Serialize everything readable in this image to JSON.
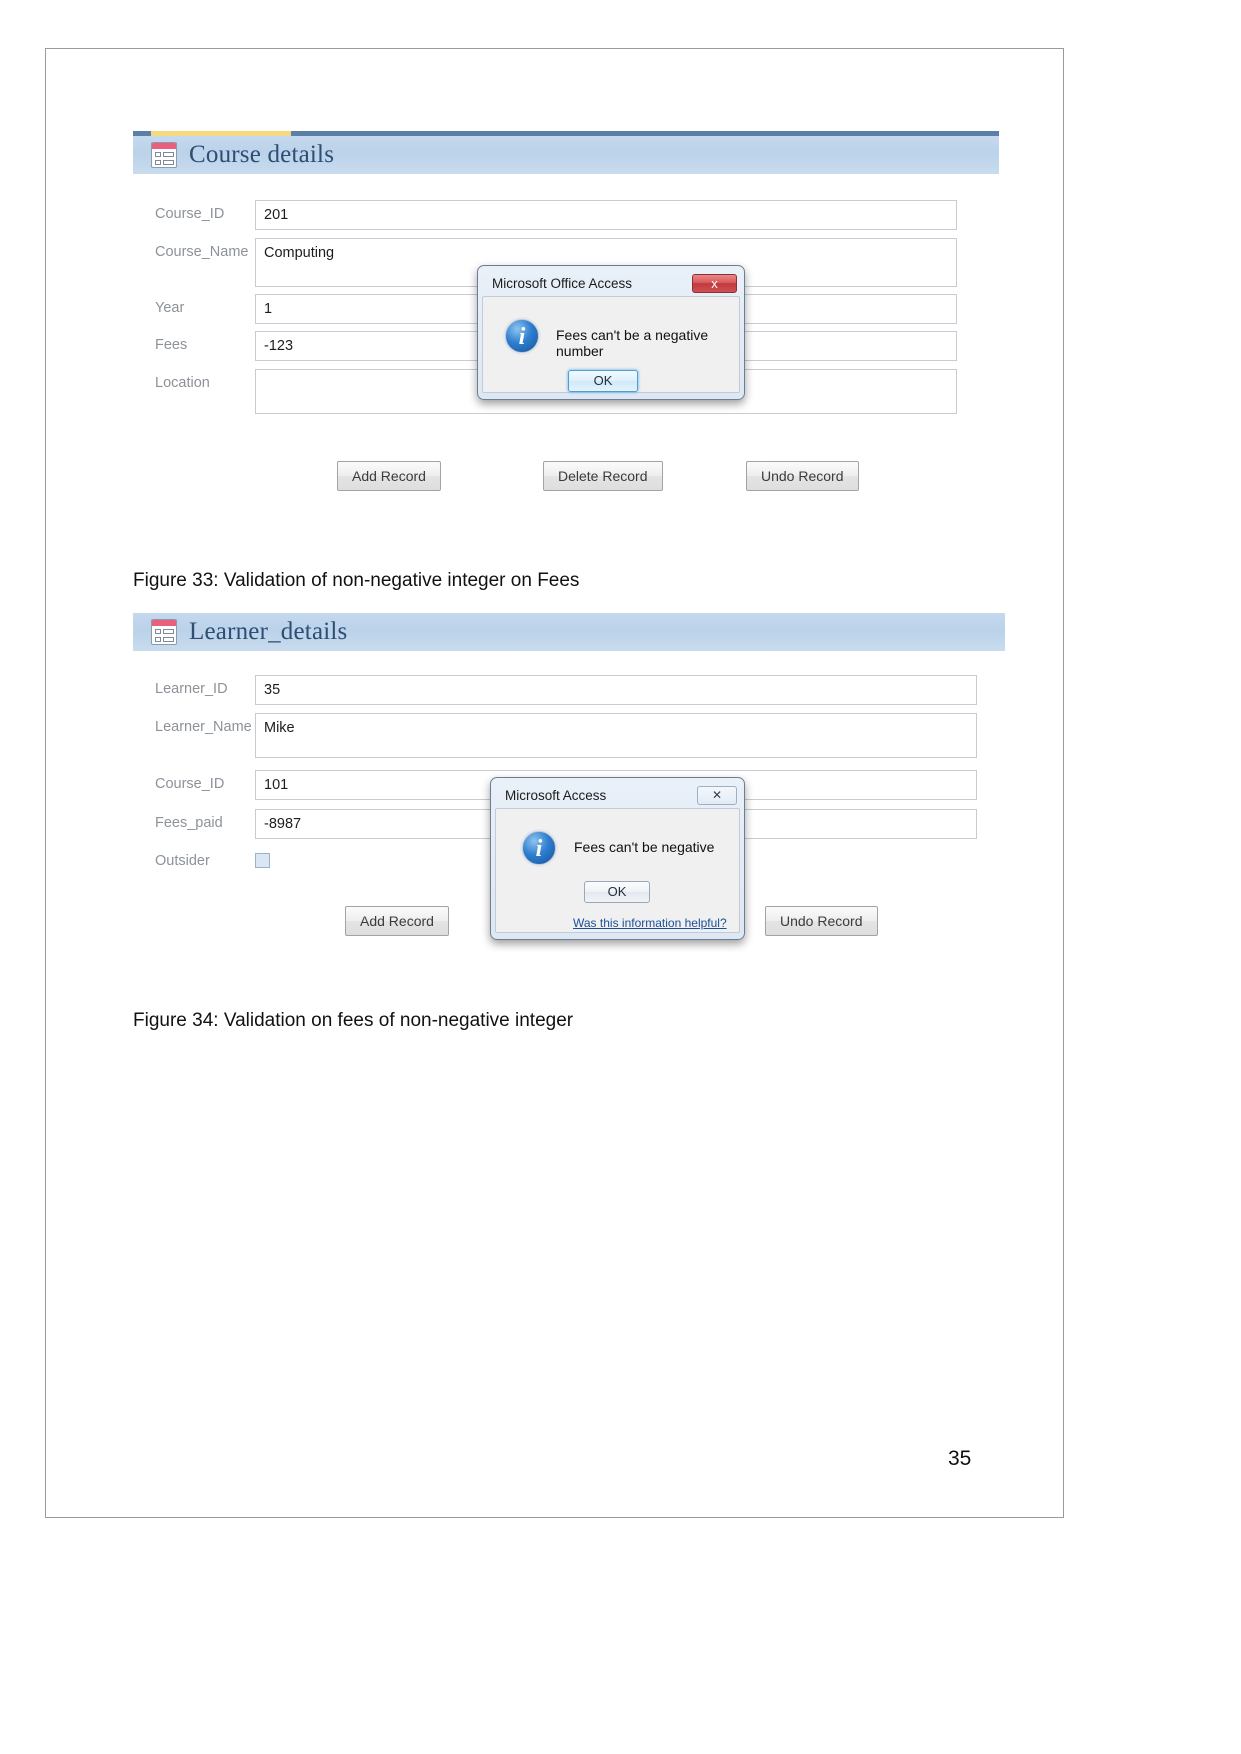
{
  "document": {
    "page_number": "35"
  },
  "figure33": {
    "caption": "Figure 33: Validation of non-negative integer on Fees",
    "form": {
      "title": "Course details",
      "icon": "form-view-icon",
      "fields": [
        {
          "label": "Course_ID",
          "value": "201",
          "type": "text"
        },
        {
          "label": "Course_Name",
          "value": "Computing",
          "type": "textarea"
        },
        {
          "label": "Year",
          "value": "1",
          "type": "text"
        },
        {
          "label": "Fees",
          "value": "-123",
          "type": "text"
        },
        {
          "label": "Location",
          "value": "",
          "type": "textarea"
        }
      ],
      "buttons": [
        {
          "label": "Add Record"
        },
        {
          "label": "Delete Record"
        },
        {
          "label": "Undo Record"
        }
      ]
    },
    "dialog": {
      "title": "Microsoft Office Access",
      "message": "Fees can't be a negative number",
      "icon": "info-icon",
      "close_label": "x",
      "ok_label": "OK"
    }
  },
  "figure34": {
    "caption": "Figure 34: Validation on fees of non-negative integer",
    "form": {
      "title": "Learner_details",
      "icon": "form-view-icon",
      "fields": [
        {
          "label": "Learner_ID",
          "value": "35",
          "type": "text"
        },
        {
          "label": "Learner_Name",
          "value": "Mike",
          "type": "textarea"
        },
        {
          "label": "Course_ID",
          "value": "101",
          "type": "text"
        },
        {
          "label": "Fees_paid",
          "value": "-8987",
          "type": "text"
        },
        {
          "label": "Outsider",
          "value": "",
          "type": "checkbox",
          "checked": false
        }
      ],
      "buttons": [
        {
          "label": "Add Record"
        },
        {
          "label": "Undo Record"
        }
      ]
    },
    "dialog": {
      "title": "Microsoft Access",
      "message": "Fees can't be negative",
      "icon": "info-icon",
      "close_label": "✕",
      "ok_label": "OK",
      "help_link": "Was this information helpful?"
    }
  },
  "colors": {
    "header_gradient_start": "#c5d9ee",
    "header_title": "#2d4d72",
    "top_strip": "#5b7fa6",
    "tab_accent": "#f5d97f",
    "field_label": "#8d9299",
    "field_border": "#c7ccd2",
    "dialog_red_close": "#c0393c",
    "link": "#1b4e9b"
  }
}
